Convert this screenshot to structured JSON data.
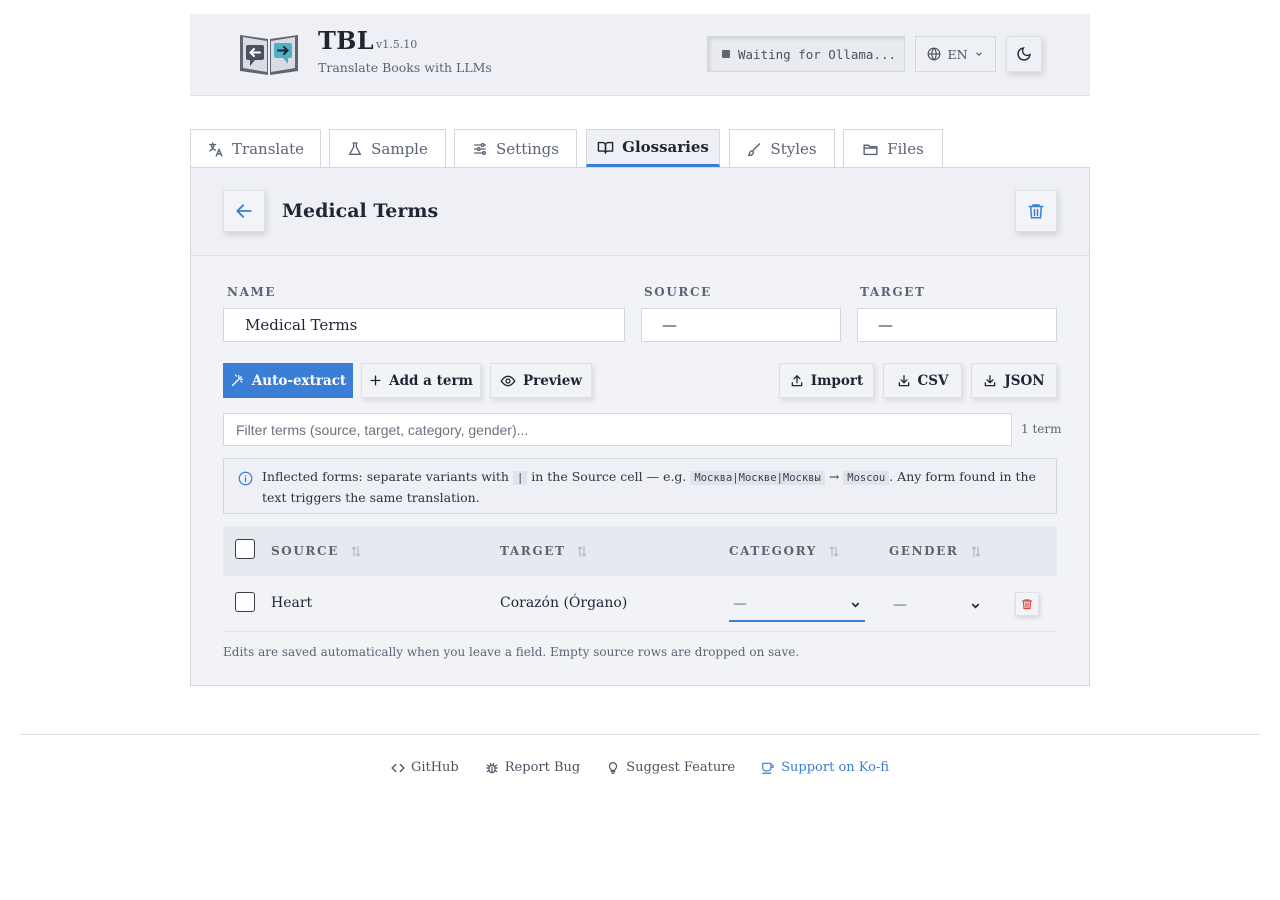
{
  "header": {
    "title": "TBL",
    "version": "v1.5.10",
    "subtitle": "Translate Books with LLMs",
    "status": "Waiting for Ollama...",
    "language": "EN",
    "logo_icon": "book-translate-logo",
    "theme_icon": "moon-icon"
  },
  "tabs": [
    {
      "label": "Translate",
      "icon": "translate-icon"
    },
    {
      "label": "Sample",
      "icon": "flask-icon"
    },
    {
      "label": "Settings",
      "icon": "sliders-icon"
    },
    {
      "label": "Glossaries",
      "icon": "book-icon",
      "active": true
    },
    {
      "label": "Styles",
      "icon": "brush-icon"
    },
    {
      "label": "Files",
      "icon": "folder-icon"
    }
  ],
  "glossary": {
    "title": "Medical Terms",
    "fields": {
      "name_label": "NAME",
      "name_value": "Medical Terms",
      "source_label": "SOURCE",
      "source_value": "—",
      "target_label": "TARGET",
      "target_value": "—"
    },
    "actions": {
      "auto_extract": "Auto-extract",
      "add_term": "Add a term",
      "preview": "Preview",
      "import": "Import",
      "csv": "CSV",
      "json": "JSON"
    },
    "filter_placeholder": "Filter terms (source, target, category, gender)...",
    "term_count": "1 term",
    "info": {
      "prefix": "Inflected forms: separate variants with",
      "separator": "|",
      "middle": "in the Source cell — e.g.",
      "example_source": "Москва|Москве|Москвы",
      "arrow": "→",
      "example_target": "Moscou",
      "suffix": ". Any form found in the text triggers the same translation."
    },
    "table": {
      "columns": [
        "SOURCE",
        "TARGET",
        "CATEGORY",
        "GENDER"
      ],
      "rows": [
        {
          "source": "Heart",
          "target": "Corazón (Órgano)",
          "category": "—",
          "gender": "—"
        }
      ]
    },
    "note": "Edits are saved automatically when you leave a field. Empty source rows are dropped on save."
  },
  "footer": {
    "links": [
      {
        "label": "GitHub",
        "icon": "code-icon"
      },
      {
        "label": "Report Bug",
        "icon": "bug-icon"
      },
      {
        "label": "Suggest Feature",
        "icon": "lightbulb-icon"
      },
      {
        "label": "Support on Ko-fi",
        "icon": "coffee-icon"
      }
    ]
  },
  "colors": {
    "accent": "#3b7ed6",
    "danger": "#e0443e",
    "text": "#1e2533",
    "muted": "#5b6474"
  }
}
